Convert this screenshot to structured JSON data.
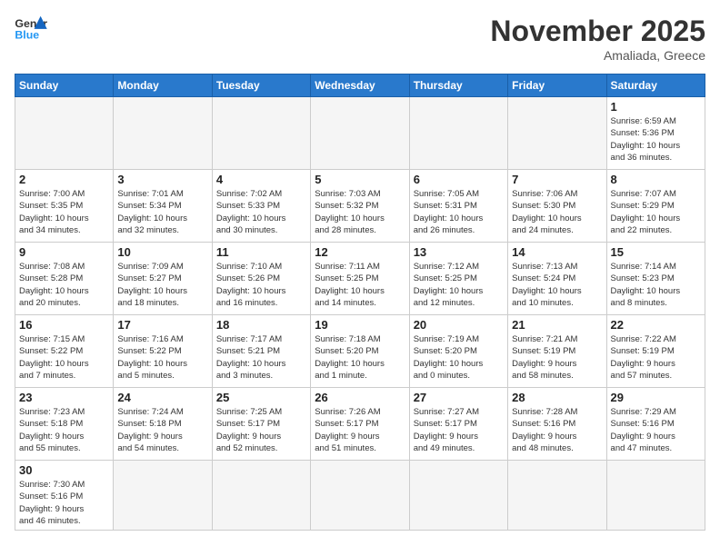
{
  "header": {
    "logo_general": "General",
    "logo_blue": "Blue",
    "month_title": "November 2025",
    "subtitle": "Amaliada, Greece"
  },
  "days_of_week": [
    "Sunday",
    "Monday",
    "Tuesday",
    "Wednesday",
    "Thursday",
    "Friday",
    "Saturday"
  ],
  "weeks": [
    [
      {
        "day": "",
        "info": ""
      },
      {
        "day": "",
        "info": ""
      },
      {
        "day": "",
        "info": ""
      },
      {
        "day": "",
        "info": ""
      },
      {
        "day": "",
        "info": ""
      },
      {
        "day": "",
        "info": ""
      },
      {
        "day": "1",
        "info": "Sunrise: 6:59 AM\nSunset: 5:36 PM\nDaylight: 10 hours\nand 36 minutes."
      }
    ],
    [
      {
        "day": "2",
        "info": "Sunrise: 7:00 AM\nSunset: 5:35 PM\nDaylight: 10 hours\nand 34 minutes."
      },
      {
        "day": "3",
        "info": "Sunrise: 7:01 AM\nSunset: 5:34 PM\nDaylight: 10 hours\nand 32 minutes."
      },
      {
        "day": "4",
        "info": "Sunrise: 7:02 AM\nSunset: 5:33 PM\nDaylight: 10 hours\nand 30 minutes."
      },
      {
        "day": "5",
        "info": "Sunrise: 7:03 AM\nSunset: 5:32 PM\nDaylight: 10 hours\nand 28 minutes."
      },
      {
        "day": "6",
        "info": "Sunrise: 7:05 AM\nSunset: 5:31 PM\nDaylight: 10 hours\nand 26 minutes."
      },
      {
        "day": "7",
        "info": "Sunrise: 7:06 AM\nSunset: 5:30 PM\nDaylight: 10 hours\nand 24 minutes."
      },
      {
        "day": "8",
        "info": "Sunrise: 7:07 AM\nSunset: 5:29 PM\nDaylight: 10 hours\nand 22 minutes."
      }
    ],
    [
      {
        "day": "9",
        "info": "Sunrise: 7:08 AM\nSunset: 5:28 PM\nDaylight: 10 hours\nand 20 minutes."
      },
      {
        "day": "10",
        "info": "Sunrise: 7:09 AM\nSunset: 5:27 PM\nDaylight: 10 hours\nand 18 minutes."
      },
      {
        "day": "11",
        "info": "Sunrise: 7:10 AM\nSunset: 5:26 PM\nDaylight: 10 hours\nand 16 minutes."
      },
      {
        "day": "12",
        "info": "Sunrise: 7:11 AM\nSunset: 5:25 PM\nDaylight: 10 hours\nand 14 minutes."
      },
      {
        "day": "13",
        "info": "Sunrise: 7:12 AM\nSunset: 5:25 PM\nDaylight: 10 hours\nand 12 minutes."
      },
      {
        "day": "14",
        "info": "Sunrise: 7:13 AM\nSunset: 5:24 PM\nDaylight: 10 hours\nand 10 minutes."
      },
      {
        "day": "15",
        "info": "Sunrise: 7:14 AM\nSunset: 5:23 PM\nDaylight: 10 hours\nand 8 minutes."
      }
    ],
    [
      {
        "day": "16",
        "info": "Sunrise: 7:15 AM\nSunset: 5:22 PM\nDaylight: 10 hours\nand 7 minutes."
      },
      {
        "day": "17",
        "info": "Sunrise: 7:16 AM\nSunset: 5:22 PM\nDaylight: 10 hours\nand 5 minutes."
      },
      {
        "day": "18",
        "info": "Sunrise: 7:17 AM\nSunset: 5:21 PM\nDaylight: 10 hours\nand 3 minutes."
      },
      {
        "day": "19",
        "info": "Sunrise: 7:18 AM\nSunset: 5:20 PM\nDaylight: 10 hours\nand 1 minute."
      },
      {
        "day": "20",
        "info": "Sunrise: 7:19 AM\nSunset: 5:20 PM\nDaylight: 10 hours\nand 0 minutes."
      },
      {
        "day": "21",
        "info": "Sunrise: 7:21 AM\nSunset: 5:19 PM\nDaylight: 9 hours\nand 58 minutes."
      },
      {
        "day": "22",
        "info": "Sunrise: 7:22 AM\nSunset: 5:19 PM\nDaylight: 9 hours\nand 57 minutes."
      }
    ],
    [
      {
        "day": "23",
        "info": "Sunrise: 7:23 AM\nSunset: 5:18 PM\nDaylight: 9 hours\nand 55 minutes."
      },
      {
        "day": "24",
        "info": "Sunrise: 7:24 AM\nSunset: 5:18 PM\nDaylight: 9 hours\nand 54 minutes."
      },
      {
        "day": "25",
        "info": "Sunrise: 7:25 AM\nSunset: 5:17 PM\nDaylight: 9 hours\nand 52 minutes."
      },
      {
        "day": "26",
        "info": "Sunrise: 7:26 AM\nSunset: 5:17 PM\nDaylight: 9 hours\nand 51 minutes."
      },
      {
        "day": "27",
        "info": "Sunrise: 7:27 AM\nSunset: 5:17 PM\nDaylight: 9 hours\nand 49 minutes."
      },
      {
        "day": "28",
        "info": "Sunrise: 7:28 AM\nSunset: 5:16 PM\nDaylight: 9 hours\nand 48 minutes."
      },
      {
        "day": "29",
        "info": "Sunrise: 7:29 AM\nSunset: 5:16 PM\nDaylight: 9 hours\nand 47 minutes."
      }
    ],
    [
      {
        "day": "30",
        "info": "Sunrise: 7:30 AM\nSunset: 5:16 PM\nDaylight: 9 hours\nand 46 minutes."
      },
      {
        "day": "",
        "info": ""
      },
      {
        "day": "",
        "info": ""
      },
      {
        "day": "",
        "info": ""
      },
      {
        "day": "",
        "info": ""
      },
      {
        "day": "",
        "info": ""
      },
      {
        "day": "",
        "info": ""
      }
    ]
  ]
}
